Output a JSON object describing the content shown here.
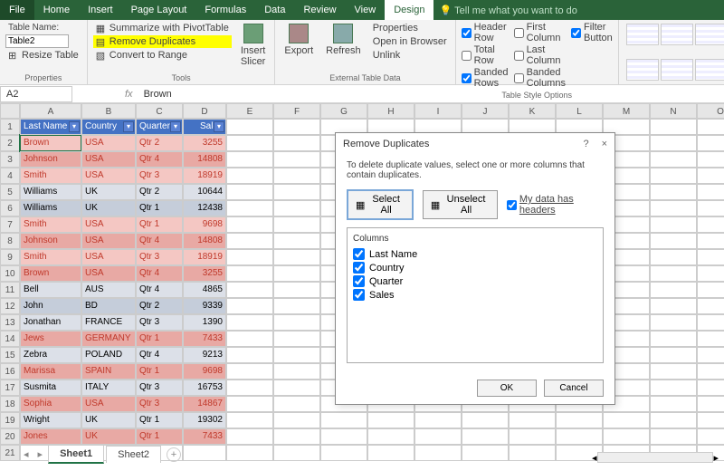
{
  "tabs": {
    "file": "File",
    "home": "Home",
    "insert": "Insert",
    "page_layout": "Page Layout",
    "formulas": "Formulas",
    "data": "Data",
    "review": "Review",
    "view": "View",
    "design": "Design",
    "tell": "Tell me what you want to do"
  },
  "ribbon": {
    "properties": {
      "label": "Properties",
      "table_name": "Table Name:",
      "table_name_val": "Table2",
      "resize": "Resize Table"
    },
    "tools": {
      "label": "Tools",
      "summarize": "Summarize with PivotTable",
      "remove": "Remove Duplicates",
      "convert": "Convert to Range",
      "slicer": "Insert\nSlicer"
    },
    "external": {
      "label": "External Table Data",
      "export": "Export",
      "refresh": "Refresh",
      "props": "Properties",
      "browser": "Open in Browser",
      "unlink": "Unlink"
    },
    "style_opts": {
      "label": "Table Style Options",
      "header_row": "Header Row",
      "total_row": "Total Row",
      "banded_rows": "Banded Rows",
      "first_col": "First Column",
      "last_col": "Last Column",
      "banded_cols": "Banded Columns",
      "filter": "Filter Button",
      "header_row_c": true,
      "total_row_c": false,
      "banded_rows_c": true,
      "first_col_c": false,
      "last_col_c": false,
      "banded_cols_c": false,
      "filter_c": true
    }
  },
  "namebox": {
    "ref": "A2",
    "fx": "fx",
    "val": "Brown"
  },
  "cols": [
    "A",
    "B",
    "C",
    "D",
    "E",
    "F",
    "G",
    "H",
    "I",
    "J",
    "K",
    "L",
    "M",
    "N",
    "O"
  ],
  "headers": {
    "a": "Last Name",
    "b": "Country",
    "c": "Quarter",
    "d": "Sales"
  },
  "rows": [
    {
      "n": 2,
      "a": "Brown",
      "b": "USA",
      "c": "Qtr 2",
      "d": "3255",
      "cls": "pink",
      "red": true
    },
    {
      "n": 3,
      "a": "Johnson",
      "b": "USA",
      "c": "Qtr 4",
      "d": "14808",
      "cls": "pink2",
      "red": true
    },
    {
      "n": 4,
      "a": "Smith",
      "b": "USA",
      "c": "Qtr 3",
      "d": "18919",
      "cls": "pink",
      "red": true
    },
    {
      "n": 5,
      "a": "Williams",
      "b": "UK",
      "c": "Qtr 2",
      "d": "10644",
      "cls": "gray"
    },
    {
      "n": 6,
      "a": "Williams",
      "b": "UK",
      "c": "Qtr 1",
      "d": "12438",
      "cls": "gray2"
    },
    {
      "n": 7,
      "a": "Smith",
      "b": "USA",
      "c": "Qtr 1",
      "d": "9698",
      "cls": "pink",
      "red": true
    },
    {
      "n": 8,
      "a": "Johnson",
      "b": "USA",
      "c": "Qtr 4",
      "d": "14808",
      "cls": "pink2",
      "red": true
    },
    {
      "n": 9,
      "a": "Smith",
      "b": "USA",
      "c": "Qtr 3",
      "d": "18919",
      "cls": "pink",
      "red": true
    },
    {
      "n": 10,
      "a": "Brown",
      "b": "USA",
      "c": "Qtr 4",
      "d": "3255",
      "cls": "pink2",
      "red": true
    },
    {
      "n": 11,
      "a": "Bell",
      "b": "AUS",
      "c": "Qtr 4",
      "d": "4865",
      "cls": "gray"
    },
    {
      "n": 12,
      "a": "John",
      "b": "BD",
      "c": "Qtr 2",
      "d": "9339",
      "cls": "gray2"
    },
    {
      "n": 13,
      "a": "Jonathan",
      "b": "FRANCE",
      "c": "Qtr 3",
      "d": "1390",
      "cls": "gray"
    },
    {
      "n": 14,
      "a": "Jews",
      "b": "GERMANY",
      "c": "Qtr 1",
      "d": "7433",
      "cls": "pink2",
      "red": true
    },
    {
      "n": 15,
      "a": "Zebra",
      "b": "POLAND",
      "c": "Qtr 4",
      "d": "9213",
      "cls": "gray"
    },
    {
      "n": 16,
      "a": "Marissa",
      "b": "SPAIN",
      "c": "Qtr 1",
      "d": "9698",
      "cls": "pink2",
      "red": true
    },
    {
      "n": 17,
      "a": "Susmita",
      "b": "ITALY",
      "c": "Qtr 3",
      "d": "16753",
      "cls": "gray"
    },
    {
      "n": 18,
      "a": "Sophia",
      "b": "USA",
      "c": "Qtr 3",
      "d": "14867",
      "cls": "pink2",
      "red": true
    },
    {
      "n": 19,
      "a": "Wright",
      "b": "UK",
      "c": "Qtr 1",
      "d": "19302",
      "cls": "gray",
      "redb": true
    },
    {
      "n": 20,
      "a": "Jones",
      "b": "UK",
      "c": "Qtr 1",
      "d": "7433",
      "cls": "pink2",
      "red": true,
      "redb": true
    }
  ],
  "blank_rows": [
    21
  ],
  "dialog": {
    "title": "Remove Duplicates",
    "help": "?",
    "close": "×",
    "text": "To delete duplicate values, select one or more columns that contain duplicates.",
    "select_all": "Select All",
    "unselect_all": "Unselect All",
    "has_headers": "My data has headers",
    "has_headers_c": true,
    "cols_label": "Columns",
    "items": [
      "Last Name",
      "Country",
      "Quarter",
      "Sales"
    ],
    "ok": "OK",
    "cancel": "Cancel"
  },
  "sheets": {
    "s1": "Sheet1",
    "s2": "Sheet2",
    "plus": "+"
  }
}
